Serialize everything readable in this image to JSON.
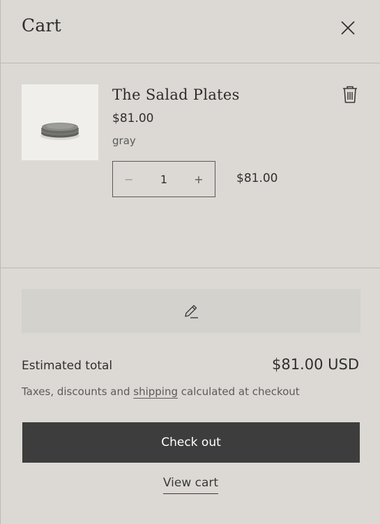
{
  "cart": {
    "title": "Cart",
    "item": {
      "name": "The Salad Plates",
      "price": "$81.00",
      "variant": "gray",
      "quantity": "1",
      "quantity_minus": "−",
      "quantity_plus": "+",
      "line_total": "$81.00"
    },
    "estimated_total_label": "Estimated total",
    "estimated_total_value": "$81.00 USD",
    "tax_note_before": "Taxes, discounts and ",
    "tax_note_link": "shipping",
    "tax_note_after": " calculated at checkout",
    "checkout_label": "Check out",
    "view_cart_label": "View cart"
  },
  "icons": {
    "close": "close-icon",
    "trash": "trash-icon",
    "pencil": "pencil-icon",
    "product_image": "salad-plates-image"
  },
  "colors": {
    "background": "#dcd9d4",
    "note_button": "#d4d2cd",
    "checkout_button": "#3d3d3d",
    "text": "#2f2f2f"
  }
}
